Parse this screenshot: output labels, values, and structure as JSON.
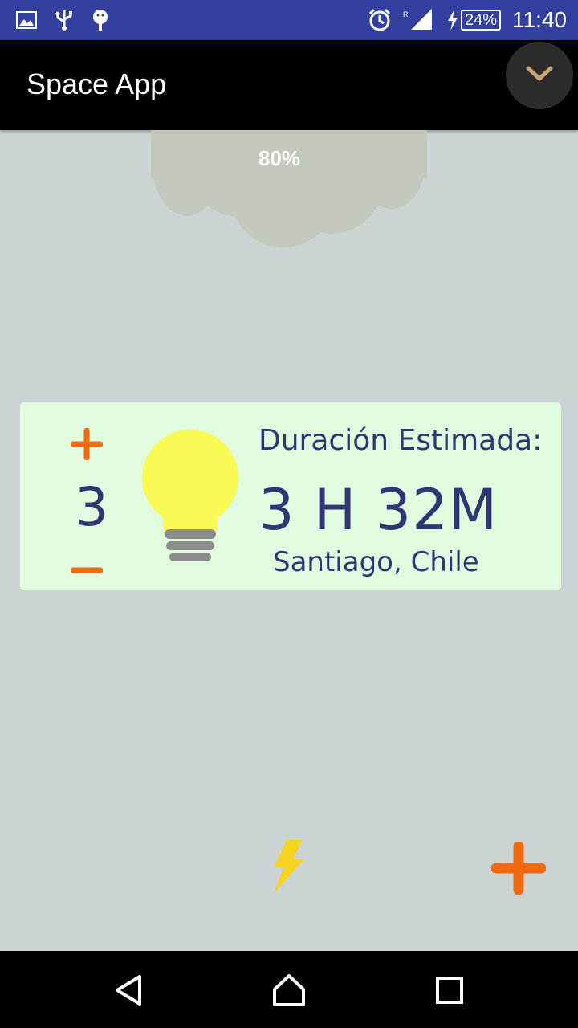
{
  "status_bar": {
    "left_icons": [
      "gallery-icon",
      "usb-icon",
      "android-debug-icon"
    ],
    "right_icons": [
      "alarm-icon",
      "signal-icon",
      "charging-icon"
    ],
    "battery_percent": "24%",
    "time": "11:40"
  },
  "app_bar": {
    "title": "Space App",
    "menu_icon": "chevron-down-icon"
  },
  "cloud": {
    "percent": "80%"
  },
  "card": {
    "count": "3",
    "increase_icon": "plus-icon",
    "decrease_icon": "minus-icon",
    "bulb_icon": "lightbulb-icon",
    "duration_label": "Duración Estimada:",
    "duration_value": "3 H 32M",
    "location": "Santiago, Chile"
  },
  "bottom": {
    "bolt_icon": "lightning-bolt-icon",
    "add_icon": "plus-icon"
  },
  "nav_bar": {
    "back_icon": "back-triangle-icon",
    "home_icon": "home-icon",
    "recents_icon": "recents-square-icon"
  },
  "colors": {
    "status_bar": "#3340a0",
    "app_bar": "#000000",
    "background": "#cbd3d4",
    "card": "#e1fbdf",
    "text": "#2f3673",
    "accent": "#f26a0f",
    "bulb": "#fafa55",
    "cloud": "#c2c8bc"
  }
}
